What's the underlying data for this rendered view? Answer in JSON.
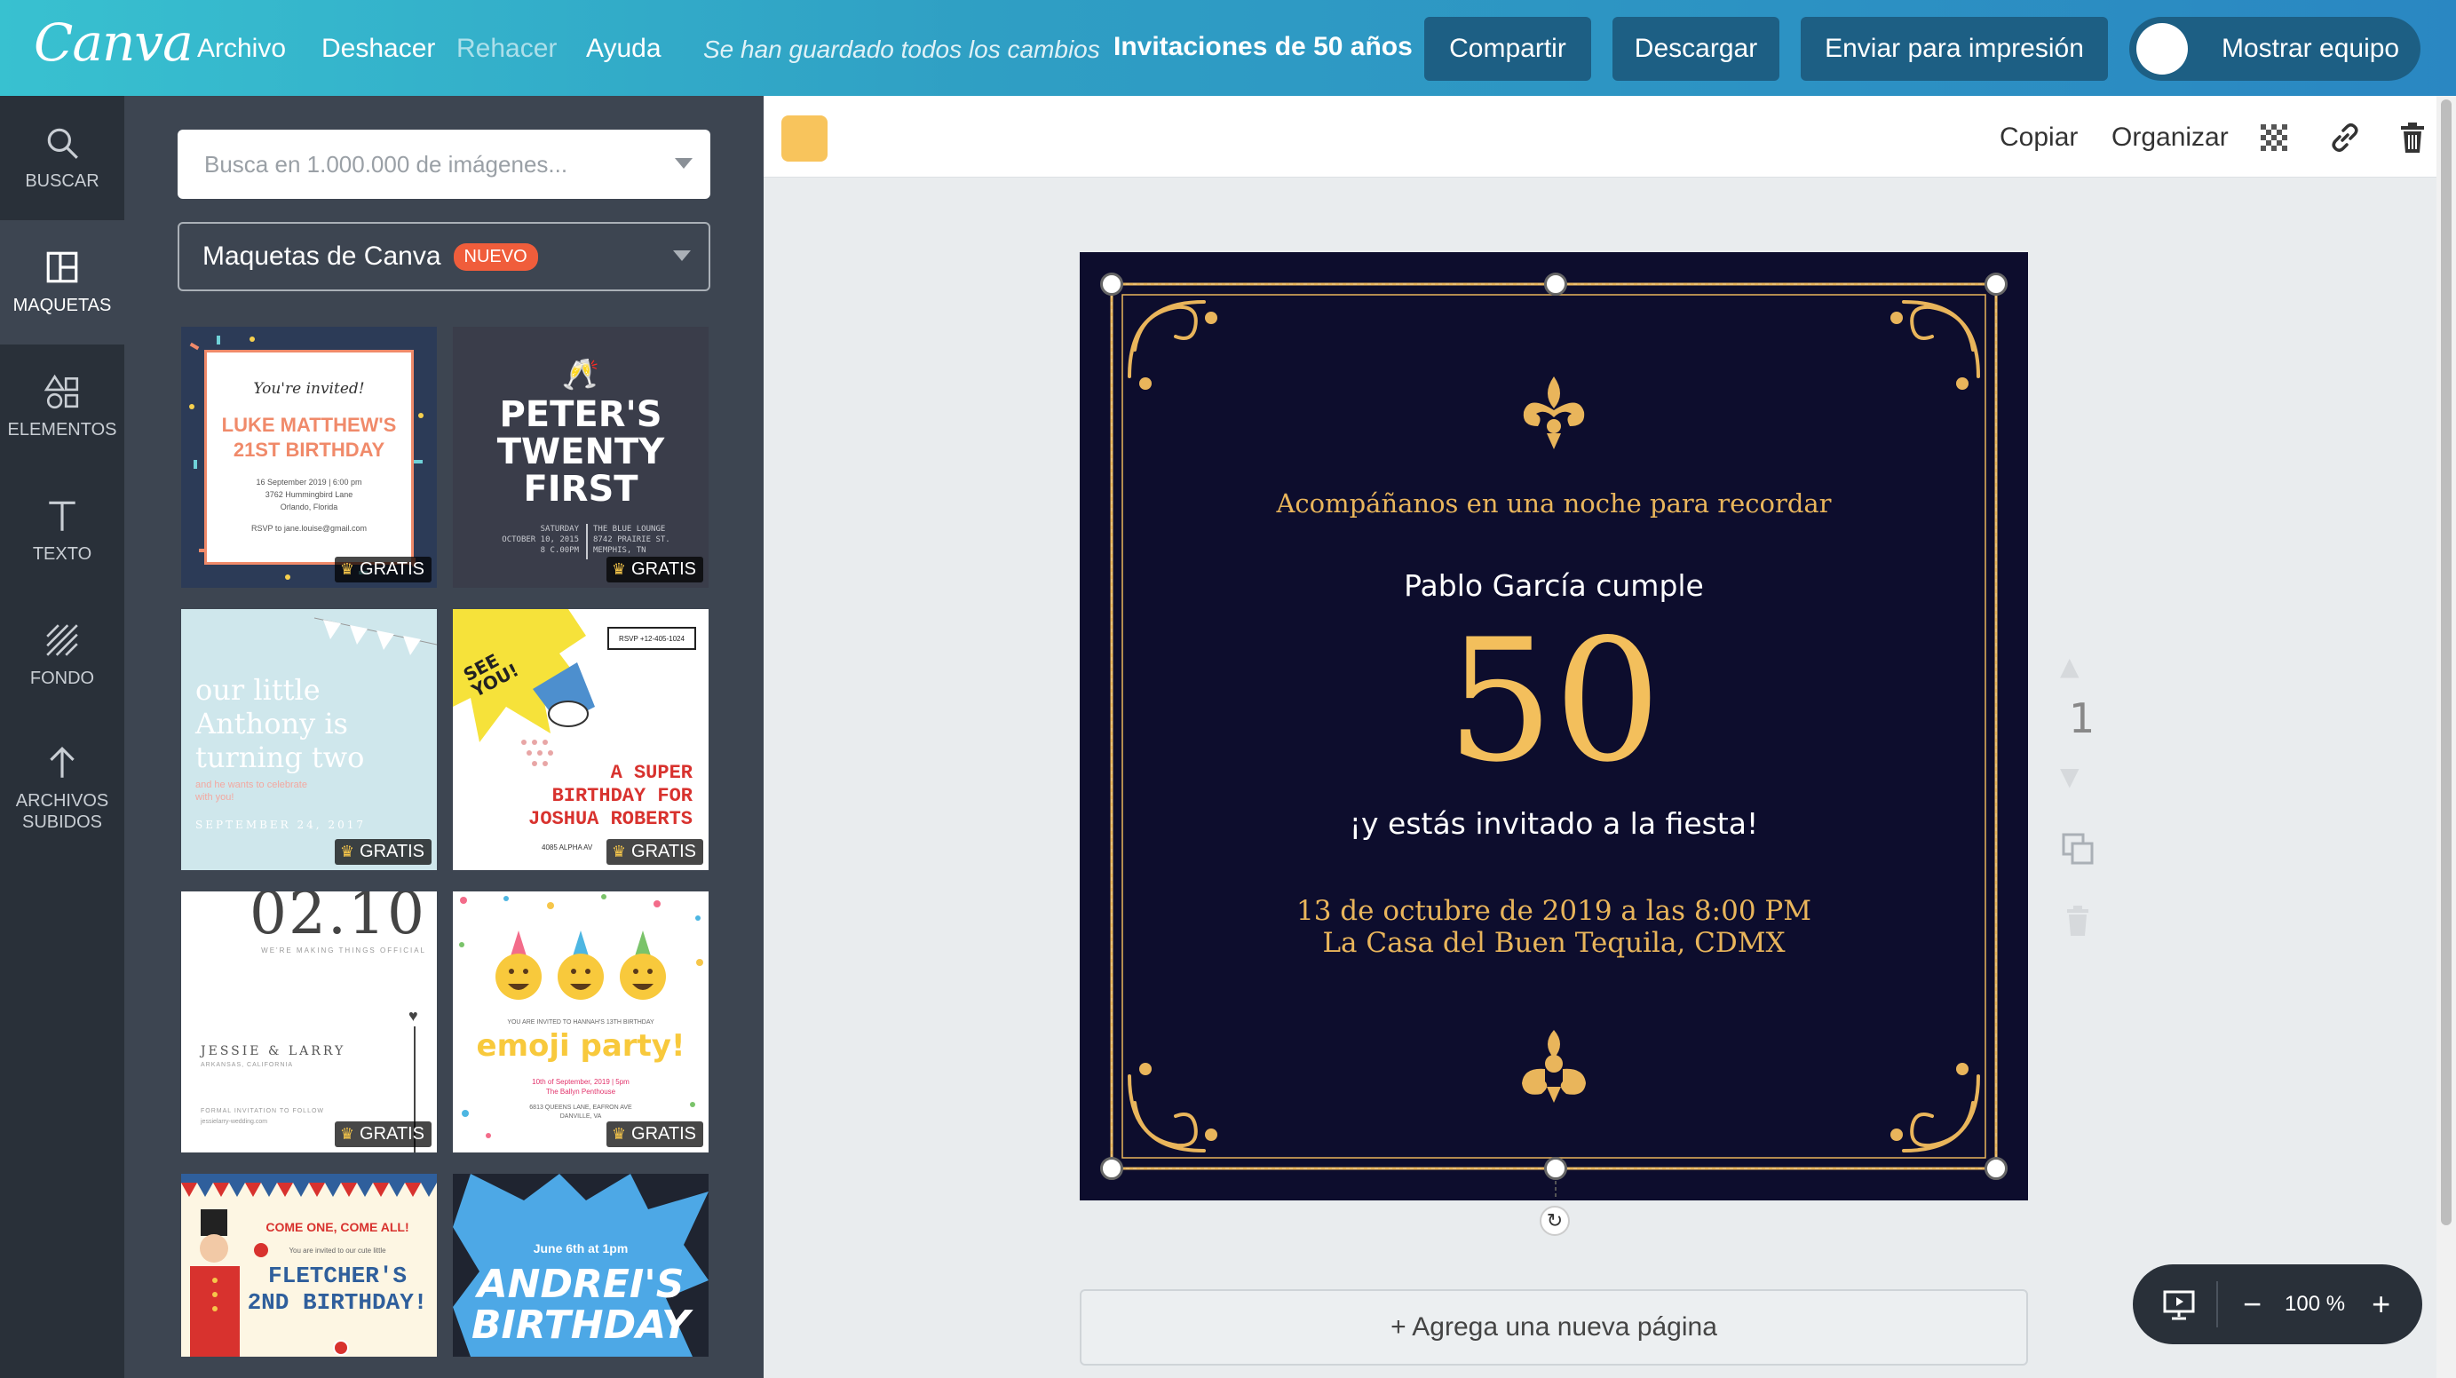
{
  "topbar": {
    "logo": "Canva",
    "menu": [
      "Archivo",
      "Deshacer",
      "Rehacer",
      "Ayuda"
    ],
    "saved_status": "Se han guardado todos los cambios",
    "doc_title": "Invitaciones de 50 años",
    "share": "Compartir",
    "download": "Descargar",
    "print": "Enviar para impresión",
    "team": "Mostrar equipo"
  },
  "rail": {
    "search": "BUSCAR",
    "layouts": "MAQUETAS",
    "elements": "ELEMENTOS",
    "text": "TEXTO",
    "background": "FONDO",
    "uploads_1": "ARCHIVOS",
    "uploads_2": "SUBIDOS"
  },
  "panel": {
    "search_placeholder": "Busca en 1.000.000 de imágenes...",
    "filter_label": "Maquetas de Canva",
    "filter_badge": "NUEVO",
    "free_label": "GRATIS",
    "t1": {
      "line1": "You're invited!",
      "line2": "LUKE MATTHEW'S",
      "line3": "21ST BIRTHDAY",
      "line4": "16 September 2019 | 6:00 pm",
      "line5": "3762 Hummingbird Lane",
      "line6": "Orlando, Florida",
      "line7": "RSVP to jane.louise@gmail.com"
    },
    "t2": {
      "line1": "PETER'S",
      "line2": "TWENTY",
      "line3": "FIRST",
      "line4": "SATURDAY",
      "line5": "OCTOBER 10, 2015",
      "line6": "8 C.00PM",
      "line7": "THE BLUE LOUNGE",
      "line8": "8742 PRAIRIE ST.",
      "line9": "MEMPHIS, TN"
    },
    "t3": {
      "line1": "our little",
      "line2": "Anthony is",
      "line3": "turning two",
      "line4": "and he wants to celebrate",
      "line5": "with you!",
      "line6": "SEPTEMBER 24, 2017"
    },
    "t4": {
      "burst": "SEE YOU!",
      "rsvp": "RSVP +12-405-1024",
      "line1": "A SUPER",
      "line2": "BIRTHDAY FOR",
      "line3": "JOSHUA ROBERTS",
      "line4": "4085 ALPHA AV"
    },
    "t5": {
      "date": "02.10",
      "tag": "WE'RE MAKING THINGS OFFICIAL",
      "names": "JESSIE & LARRY",
      "place": "ARKANSAS, CALIFORNIA",
      "note": "FORMAL INVITATION TO FOLLOW",
      "site": "jessielarry-wedding.com"
    },
    "t6": {
      "line1": "YOU ARE INVITED TO HANNAH'S 13TH BIRTHDAY",
      "title": "emoji party!",
      "line2": "10th of September, 2019 | 5pm",
      "line3": "The Ballyn Penthouse",
      "line4": "6813 QUEENS LANE, EAFRON AVE",
      "line5": "DANVILLE, VA"
    },
    "t7": {
      "line1": "COME ONE, COME ALL!",
      "line2": "You are invited to our cute little",
      "line3": "FLETCHER'S",
      "line4": "2ND BIRTHDAY!"
    },
    "t8": {
      "line1": "June 6th at 1pm",
      "line2": "ANDREI'S",
      "line3": "BIRTHDAY"
    }
  },
  "workbar": {
    "copy": "Copiar",
    "arrange": "Organizar"
  },
  "card": {
    "line1": "Acompáñanos en una noche para recordar",
    "line2": "Pablo García cumple",
    "number": "50",
    "line3": "¡y estás invitado a la fiesta!",
    "line4": "13 de octubre de 2019 a las 8:00 PM",
    "line5": "La Casa del Buen Tequila, CDMX"
  },
  "page_number": "1",
  "add_page": "+ Agrega una nueva página",
  "zoom": {
    "level": "100 %",
    "minus": "−",
    "plus": "+"
  },
  "colors": {
    "card_bg": "#0d0d2d",
    "gold": "#e9b55b",
    "topbar": "#2f9fc4",
    "panel": "#3d4551",
    "rail": "#293039"
  }
}
